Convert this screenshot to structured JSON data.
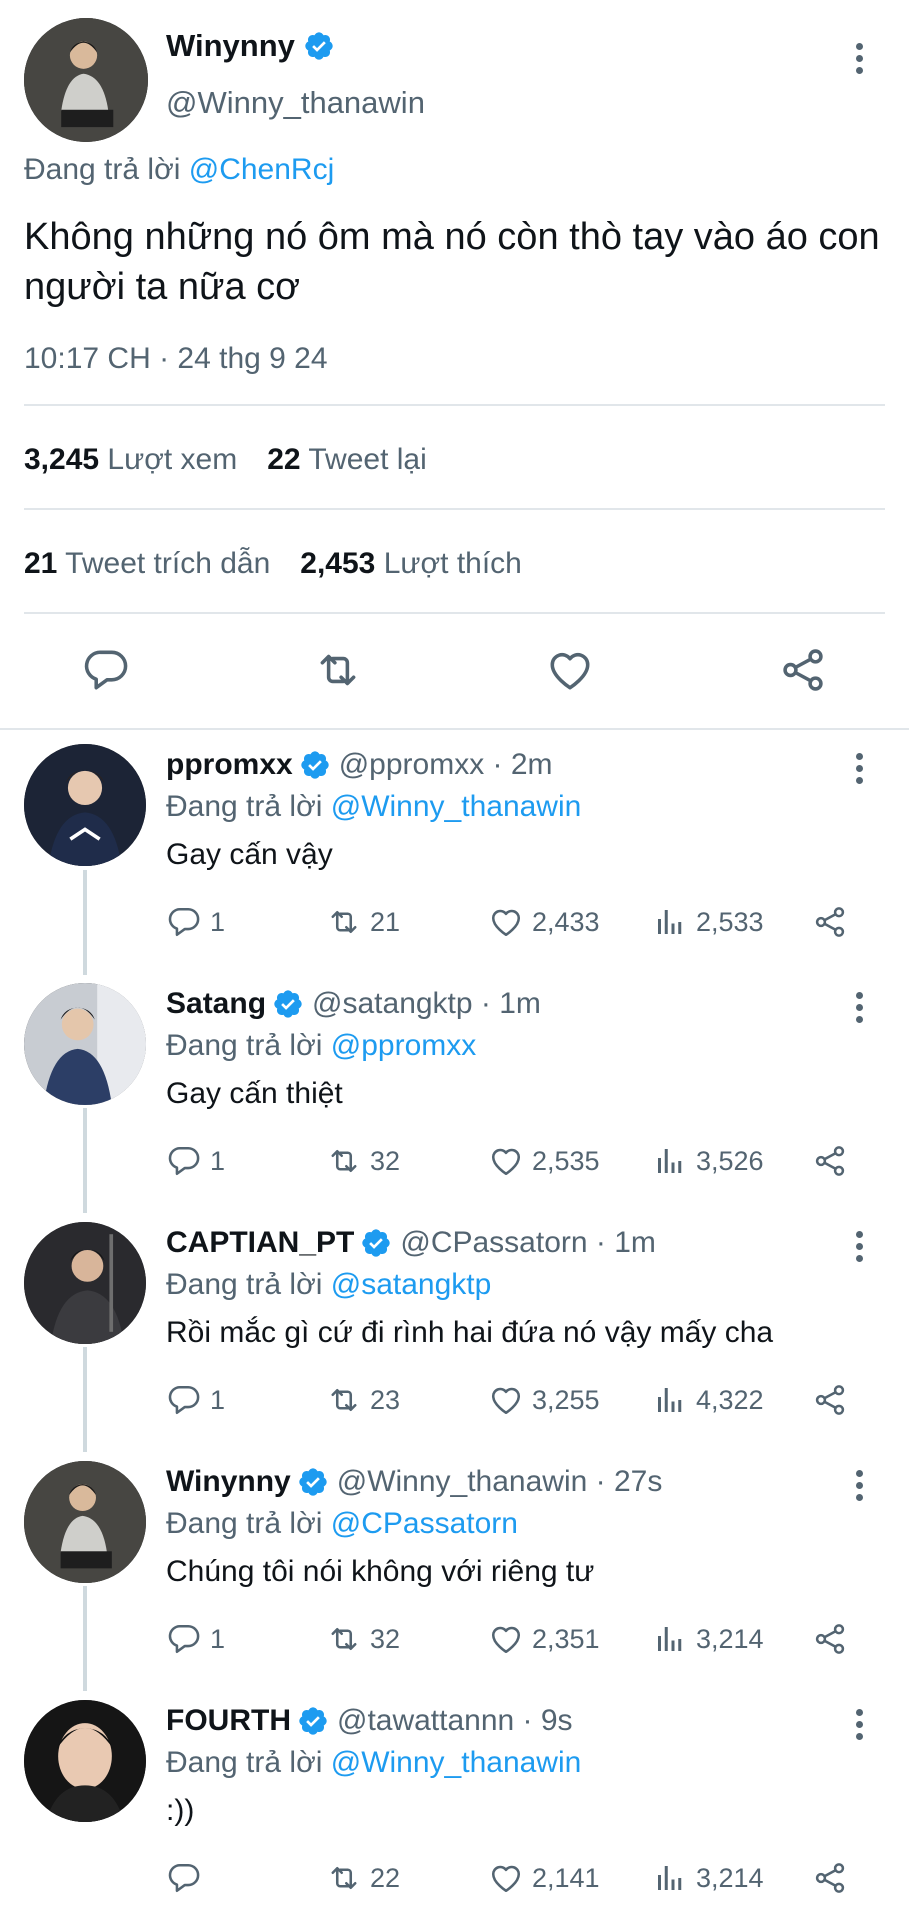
{
  "main_tweet": {
    "name": "Winynny",
    "handle": "@Winny_thanawin",
    "replying_prefix": "Đang trả lời",
    "replying_to": "@ChenRcj",
    "text": "Không những nó ôm mà nó còn thò tay vào áo con người ta nữa cơ",
    "timestamp": "10:17 CH · 24 thg 9 24",
    "views_count": "3,245",
    "views_label": "Lượt xem",
    "retweets_count": "22",
    "retweets_label": "Tweet lại",
    "quotes_count": "21",
    "quotes_label": "Tweet trích dẫn",
    "likes_count": "2,453",
    "likes_label": "Lượt thích"
  },
  "replies": [
    {
      "name": "ppromxx",
      "handle": "@ppromxx · 2m",
      "replying_prefix": "Đang trả lời",
      "replying_to": "@Winny_thanawin",
      "text": "Gay cấn vậy",
      "comments": "1",
      "retweets": "21",
      "likes": "2,433",
      "views": "2,533"
    },
    {
      "name": "Satang",
      "handle": "@satangktp · 1m",
      "replying_prefix": "Đang trả lời",
      "replying_to": "@ppromxx",
      "text": "Gay cấn thiệt",
      "comments": "1",
      "retweets": "32",
      "likes": "2,535",
      "views": "3,526"
    },
    {
      "name": "CAPTIAN_PT",
      "handle": "@CPassatorn · 1m",
      "replying_prefix": "Đang trả lời",
      "replying_to": "@satangktp",
      "text": "Rồi mắc gì cứ đi rình hai đứa nó vậy mấy cha",
      "comments": "1",
      "retweets": "23",
      "likes": "3,255",
      "views": "4,322"
    },
    {
      "name": "Winynny",
      "handle": "@Winny_thanawin · 27s",
      "replying_prefix": "Đang trả lời",
      "replying_to": "@CPassatorn",
      "text": "Chúng tôi nói không với riêng tư",
      "comments": "1",
      "retweets": "32",
      "likes": "2,351",
      "views": "3,214"
    },
    {
      "name": "FOURTH",
      "handle": "@tawattannn · 9s",
      "replying_prefix": "Đang trả lời",
      "replying_to": "@Winny_thanawin",
      "text": ":))",
      "comments": "",
      "retweets": "22",
      "likes": "2,141",
      "views": "3,214"
    }
  ],
  "icons": {
    "verified": "verified-badge-icon",
    "more": "more-vertical-icon",
    "reply": "comment-icon",
    "retweet": "retweet-icon",
    "like": "heart-icon",
    "views": "analytics-icon",
    "share": "share-icon"
  },
  "colors": {
    "accent": "#1d9bf0",
    "secondary_text": "#536471",
    "primary_text": "#0f1419"
  }
}
